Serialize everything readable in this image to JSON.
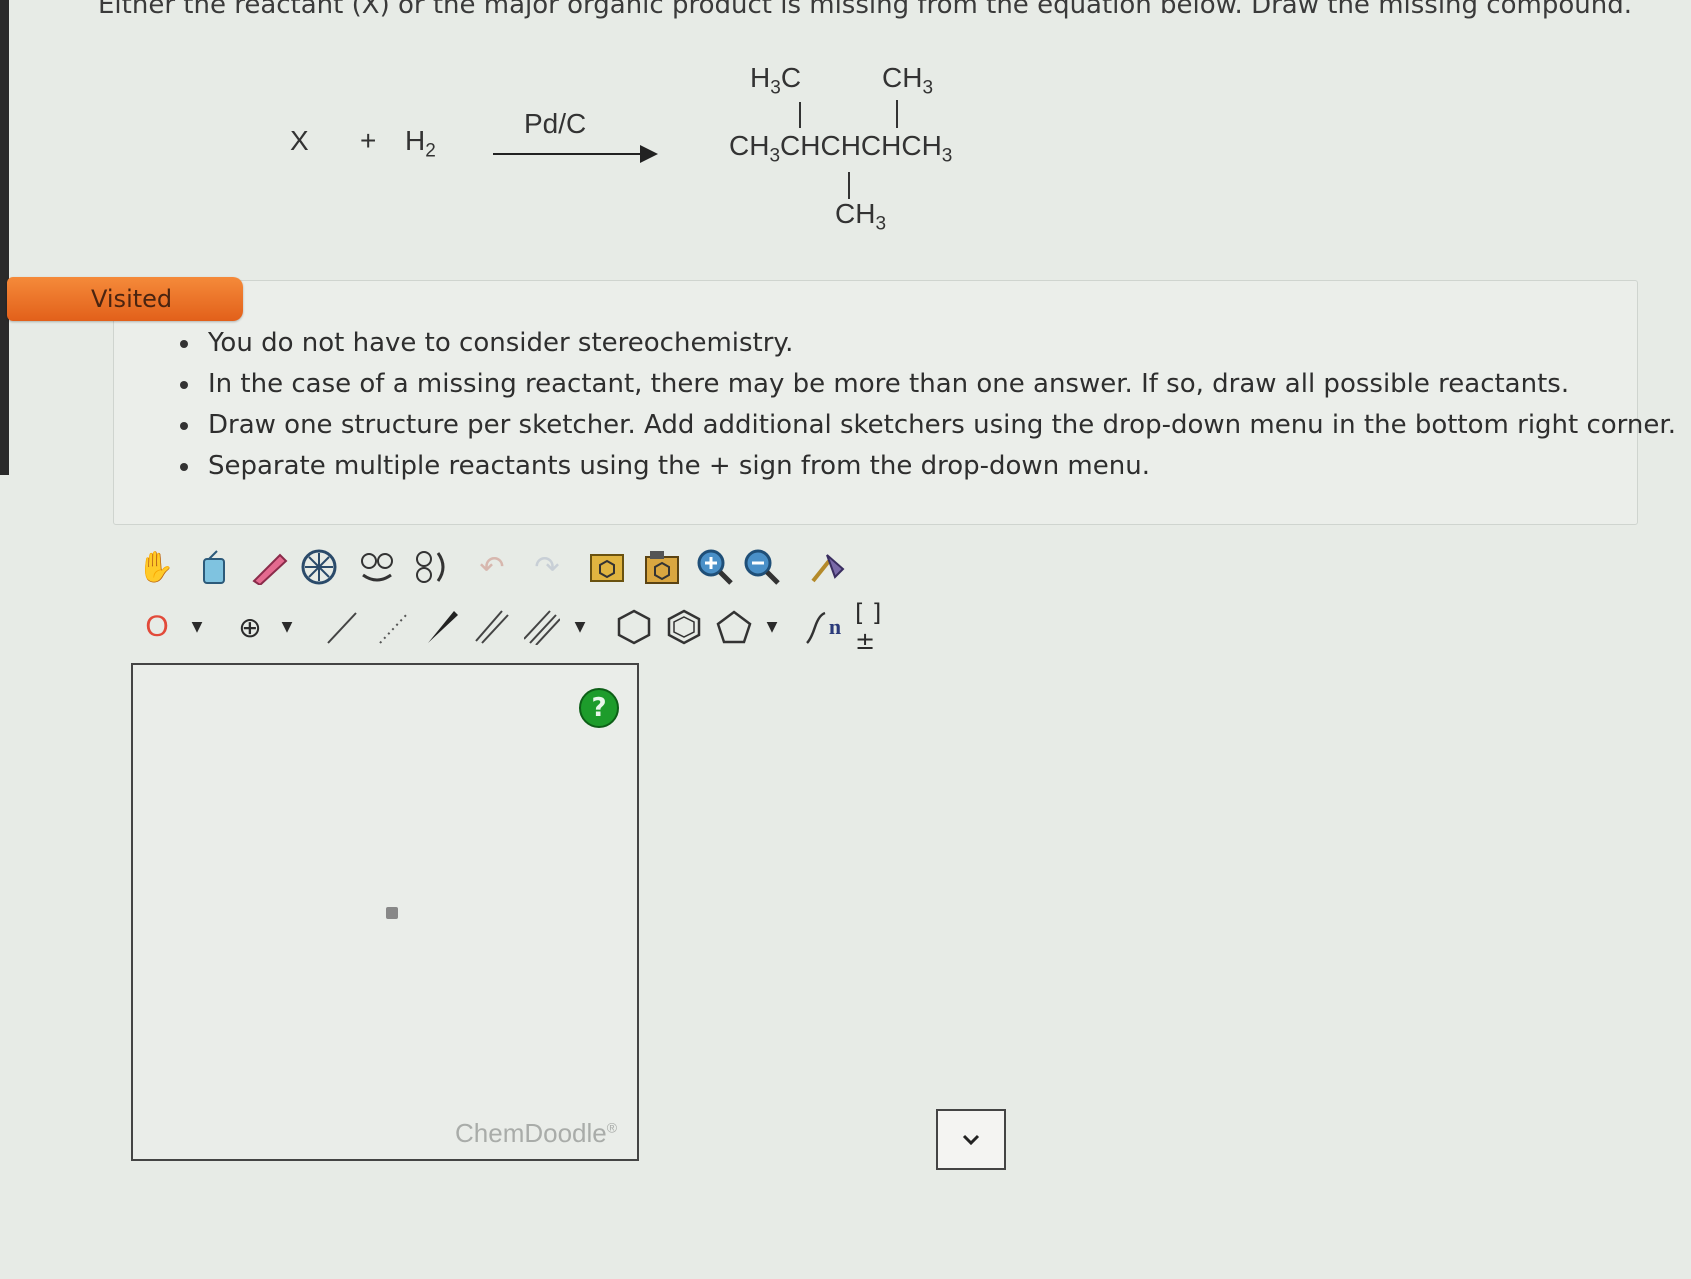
{
  "question": "Either the reactant (X) or the major organic product is missing from the equation below. Draw the missing compound.",
  "equation": {
    "reactant": "X",
    "plus": "+",
    "h2_main": "H",
    "h2_sub": "2",
    "catalyst": "Pd/C",
    "product": {
      "top_left": {
        "main": "H",
        "sub": "3",
        "tail": "C"
      },
      "top_right": {
        "main": "CH",
        "sub": "3"
      },
      "chain_a": "CH",
      "chain_a_sub": "3",
      "chain_b": "CHCHCHCH",
      "chain_b_sub": "3",
      "bottom": {
        "main": "CH",
        "sub": "3"
      }
    }
  },
  "badge": "Visited",
  "instructions": [
    "You do not have to consider stereochemistry.",
    "In the case of a missing reactant, there may be more than one answer. If so, draw all possible reactants.",
    "Draw one structure per sketcher. Add additional sketchers using the drop-down menu in the bottom right corner.",
    "Separate multiple reactants using the + sign from the drop-down menu."
  ],
  "toolbar": {
    "atom_label": "O",
    "charge_label": "⊕",
    "repeat_label": "n",
    "bracket_label": "[ ]±"
  },
  "sketcher": {
    "help": "?",
    "brand": "ChemDoodle",
    "brand_mark": "®"
  },
  "colors": {
    "badge": "#e8701f",
    "help": "#1d9c2b",
    "background": "#e7ebe6"
  }
}
